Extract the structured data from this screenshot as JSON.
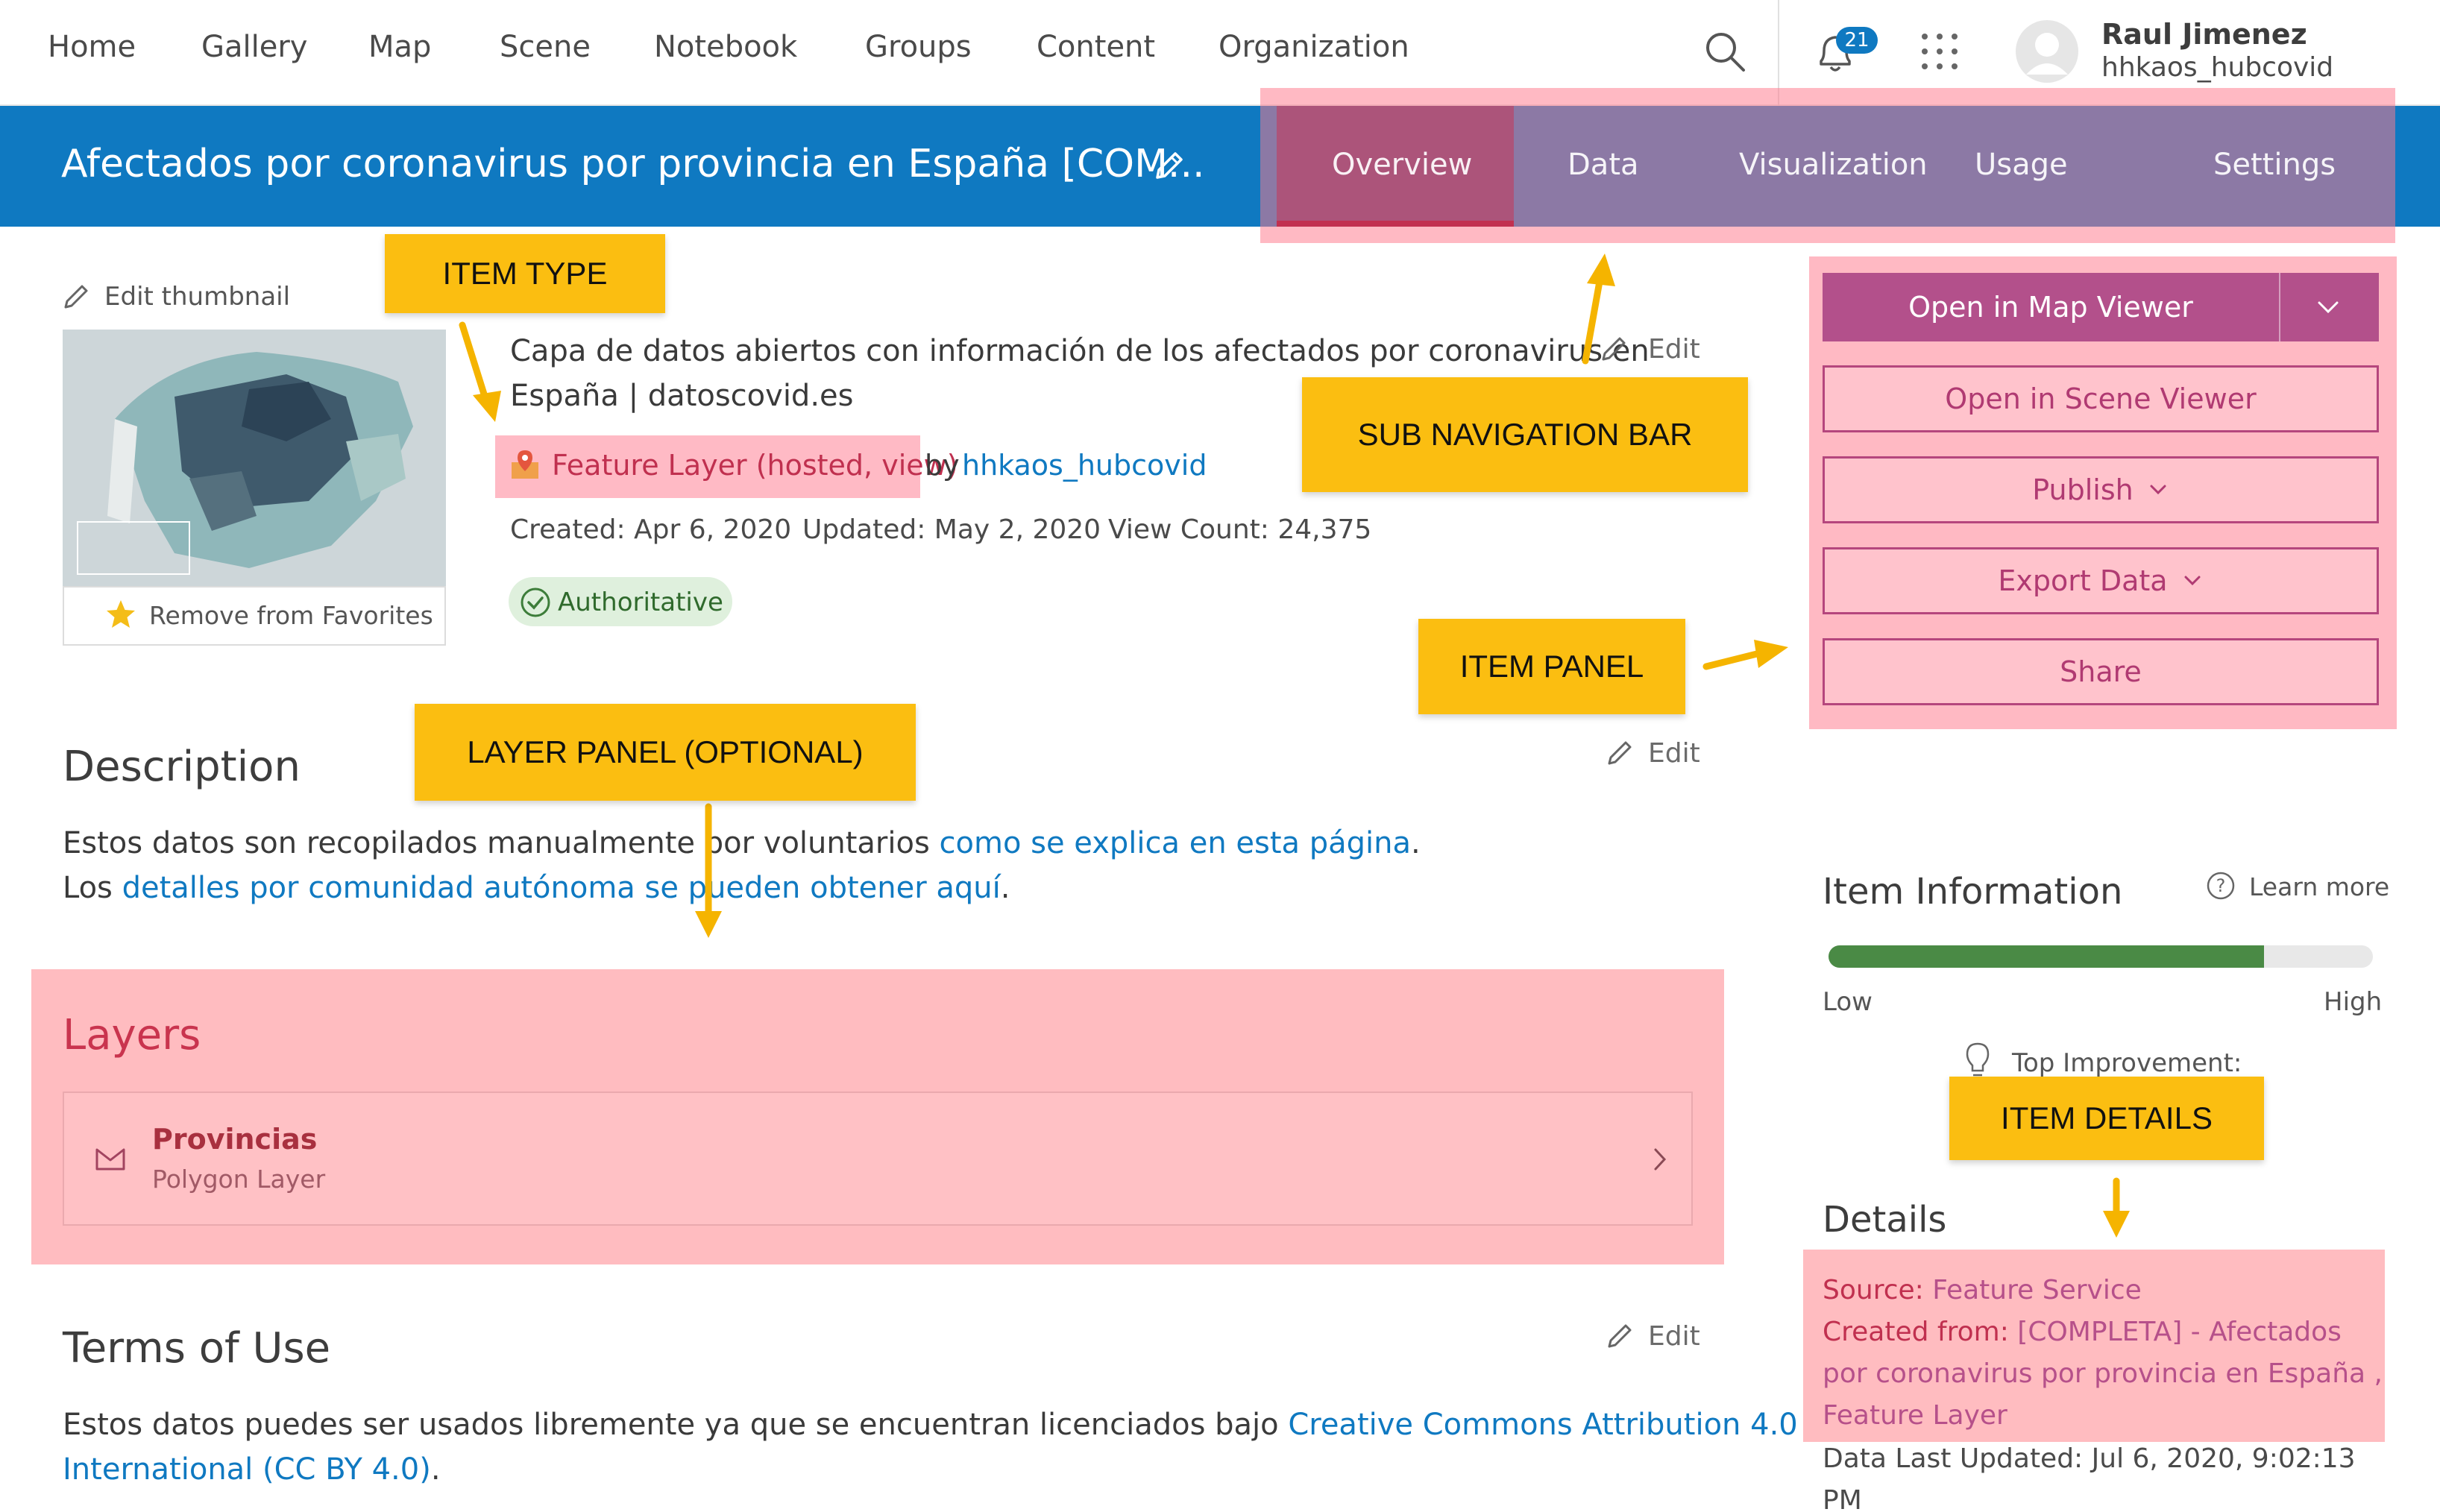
{
  "topnav": {
    "items": [
      "Home",
      "Gallery",
      "Map",
      "Scene",
      "Notebook",
      "Groups",
      "Content",
      "Organization"
    ],
    "notification_count": "21",
    "user_name": "Raul Jimenez",
    "user_handle": "hhkaos_hubcovid"
  },
  "header": {
    "title": "Afectados por coronavirus por provincia en España [COM...",
    "tabs": [
      "Overview",
      "Data",
      "Visualization",
      "Usage",
      "Settings"
    ],
    "active_tab": "Overview"
  },
  "thumbnail": {
    "edit_label": "Edit thumbnail",
    "favorites_label": "Remove from Favorites"
  },
  "summary": {
    "line1": "Capa de datos abiertos con información de los afectados por coronavirus en",
    "line2": "España | datoscovid.es",
    "edit_label": "Edit",
    "item_type": "Feature Layer (hosted, view)",
    "by": "by",
    "owner": "hhkaos_hubcovid",
    "created": "Created: Apr 6, 2020",
    "updated": "Updated: May 2, 2020",
    "view_count": "View Count: 24,375",
    "badge": "Authoritative"
  },
  "description": {
    "title": "Description",
    "edit_label": "Edit",
    "line1_text": "Estos datos son recopilados manualmente por voluntarios ",
    "line1_link": "como se explica en esta página",
    "line1_end": ".",
    "line2_text": "Los ",
    "line2_link": "detalles por comunidad autónoma se pueden obtener aquí",
    "line2_end": "."
  },
  "layers": {
    "title": "Layers",
    "items": [
      {
        "name": "Provincias",
        "type": "Polygon Layer"
      }
    ]
  },
  "terms": {
    "title": "Terms of Use",
    "edit_label": "Edit",
    "line1_text": "Estos datos puedes ser usados libremente ya que se encuentran licenciados bajo ",
    "line1_link": "Creative Commons Attribution 4.0",
    "line2_link": "International (CC BY 4.0)",
    "line2_end": "."
  },
  "item_panel": {
    "open_map_viewer": "Open in Map Viewer",
    "open_scene_viewer": "Open in Scene Viewer",
    "publish": "Publish",
    "export_data": "Export Data",
    "share": "Share"
  },
  "item_info": {
    "title": "Item Information",
    "learn_more": "Learn more",
    "low": "Low",
    "high": "High",
    "score_fraction": 0.8,
    "top_improvement": "Top Improvement:"
  },
  "details": {
    "title": "Details",
    "source_label": "Source:",
    "source_value": "Feature Service",
    "created_from_label": "Created from:",
    "created_from_value_1": "[COMPLETA] - Afectados",
    "created_from_value_2": "por coronavirus por provincia en España ,",
    "created_from_value_3": "Feature Layer",
    "last_updated_1": "Data Last Updated: Jul 6, 2020, 9:02:13",
    "last_updated_2": "PM"
  },
  "callouts": {
    "item_type": "ITEM TYPE",
    "sub_nav": "SUB NAVIGATION BAR",
    "item_panel": "ITEM PANEL",
    "layer_panel": "LAYER PANEL (OPTIONAL)",
    "item_details": "ITEM DETAILS"
  },
  "colors": {
    "header_blue": "#0f79c1",
    "callout_yellow": "#fbbe11",
    "highlight_pink": "#ff8296",
    "accent_magenta": "#b03a72",
    "quality_green": "#4a8a45"
  }
}
